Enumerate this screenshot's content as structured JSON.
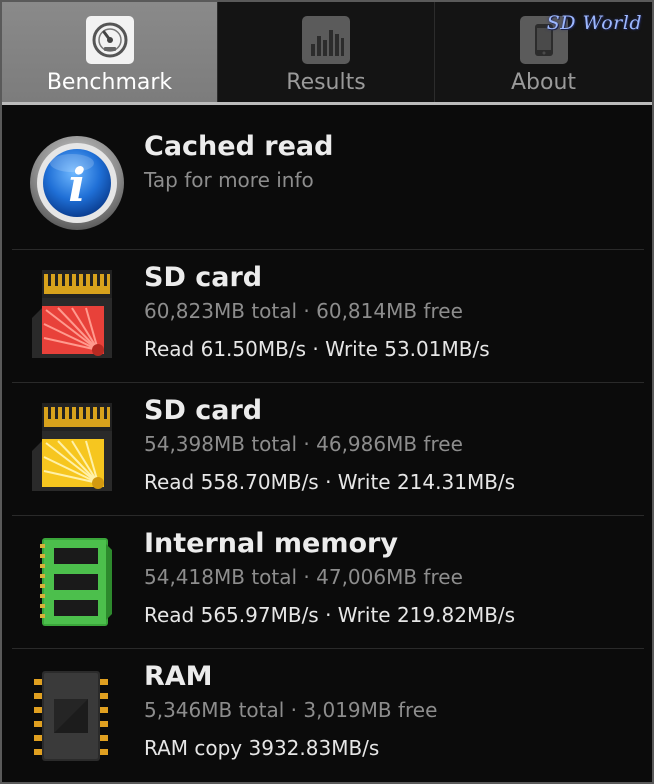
{
  "tabs": [
    {
      "label": "Benchmark",
      "icon": "speedometer-icon",
      "selected": true
    },
    {
      "label": "Results",
      "icon": "bar-chart-icon",
      "selected": false
    },
    {
      "label": "About",
      "icon": "phone-icon",
      "selected": false
    }
  ],
  "watermark": "SD World",
  "info_row": {
    "title": "Cached read",
    "subtitle": "Tap for more info",
    "icon": "info-icon"
  },
  "devices": [
    {
      "title": "SD card",
      "capacity": "60,823MB total · 60,814MB free",
      "speed": "Read 61.50MB/s · Write 53.01MB/s",
      "icon": "sd-card-red-icon",
      "accent": "#e8413a"
    },
    {
      "title": "SD card",
      "capacity": "54,398MB total · 46,986MB free",
      "speed": "Read 558.70MB/s · Write 214.31MB/s",
      "icon": "sd-card-yellow-icon",
      "accent": "#f6c61f"
    },
    {
      "title": "Internal memory",
      "capacity": "54,418MB total · 47,006MB free",
      "speed": "Read 565.97MB/s · Write 219.82MB/s",
      "icon": "memory-chip-icon",
      "accent": "#3aa63a"
    },
    {
      "title": "RAM",
      "capacity": "5,346MB total · 3,019MB free",
      "speed": "RAM copy 3932.83MB/s",
      "icon": "ram-chip-icon",
      "accent": "#e0a020"
    }
  ]
}
